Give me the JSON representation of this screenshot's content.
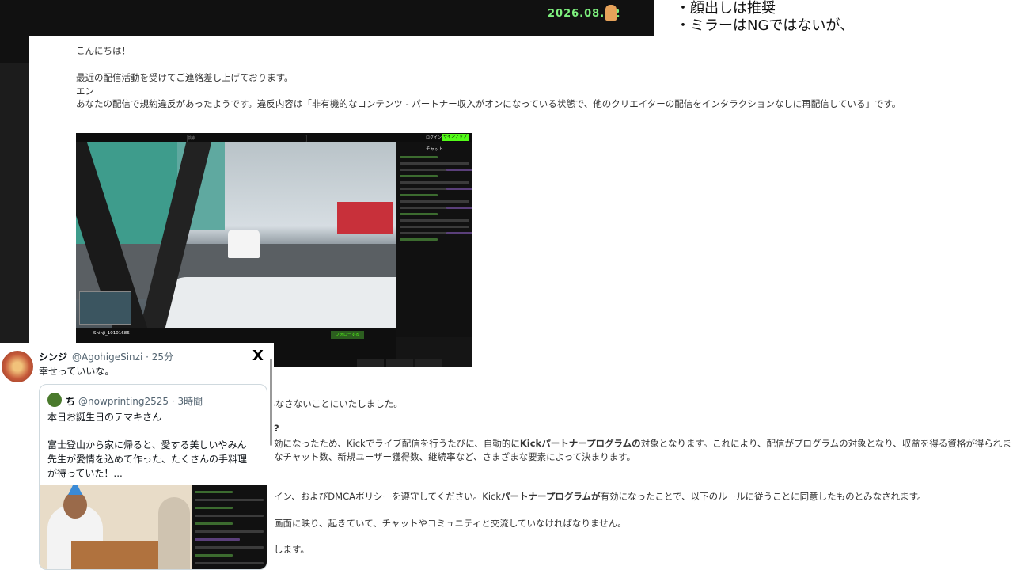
{
  "banner": {
    "date": "2026.08.02"
  },
  "notes": {
    "line1": "・顔出しは推奨",
    "line2": "・ミラーはNGではないが、"
  },
  "email": {
    "greeting": "こんにちは！",
    "line1": "最近の配信活動を受けてご連絡差し上げております。",
    "line2": "エン",
    "line3": "あなたの配信で規約違反があったようです。違反内容は「非有機的なコンテンツ - パートナー収入がオンになっている状態で、他のクリエイターの配信をインタラクションなしに再配信している」です。",
    "para2": "して、誠意を示すために、この配信を違反とはみなさないことにいたしました。",
    "q": "?",
    "para3a_pre": "効になったため、Kickでライブ配信を行うたびに、自動的に",
    "para3a_bold": "Kickパートナープログラムの",
    "para3a_post": "対象となります。これにより、配信がプログラムの対象となり、収益を得る資格が得られま",
    "para3b": "なチャット数、新規ユーザー獲得数、継続率など、さまざまな要素によって決まります。",
    "para4_pre": "イン、およびDMCAポリシーを遵守してください。Kick",
    "para4_bold": "パートナープログラムが",
    "para4_post": "有効になったことで、以下のルールに従うことに同意したものとみなされます。",
    "para5": "画面に映り、起きていて、チャットやコミュニティと交流していなければなりません。",
    "para6": "します。"
  },
  "screenshot": {
    "search_placeholder": "検索",
    "login": "ログイン",
    "signup": "サインアップ",
    "chat_title": "チャット",
    "streamer": "Shinji_10101686",
    "follow": "フォローする"
  },
  "tweet": {
    "name": "シンジ",
    "handle_time": "@AgohigeSinzi · 25分",
    "body": "幸せっていいな。",
    "x_logo": "X",
    "quote": {
      "name": "ち",
      "handle_time": "@nowprinting2525 · 3時間",
      "line1": "本日お誕生日のテマキさん",
      "line2": "富士登山から家に帰ると、愛する美しいやみん",
      "line3": "先生が愛情を込めて作った、たくさんの手料理",
      "line4": "が待っていた！..."
    }
  }
}
